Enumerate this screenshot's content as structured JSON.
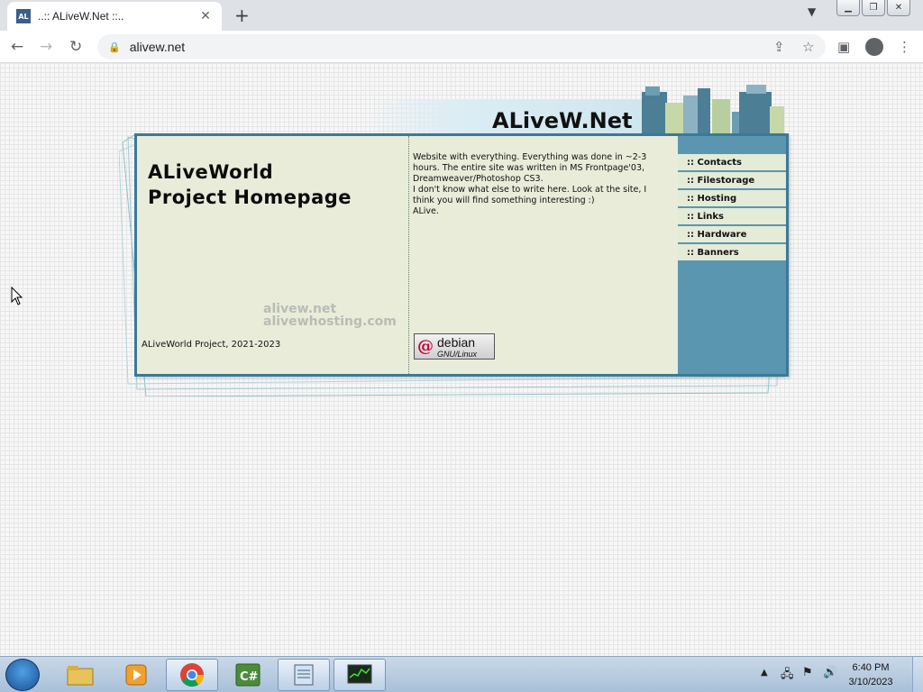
{
  "browser": {
    "tab_title": "..:: ALiveW.Net ::..",
    "favicon_text": "AL",
    "new_tab": "+",
    "close": "✕",
    "url": "alivew.net"
  },
  "site": {
    "title": "ALiveW.Net",
    "heading_line1": "ALiveWorld",
    "heading_line2": "Project Homepage",
    "watermark_line1": "alivew.net",
    "watermark_line2": "alivewhosting.com",
    "copyright": "ALiveWorld Project, 2021-2023",
    "description": [
      "Website with everything. Everything was done in ~2-3",
      "hours. The entire site was written in MS Frontpage'03,",
      "Dreamweaver/Photoshop CS3.",
      "I don't know what else to write here. Look at the site, I",
      "think you will find something interesting :)",
      "ALive."
    ],
    "debian_line1": "debian",
    "debian_line2": "GNU/Linux",
    "menu": [
      ":: Contacts",
      ":: Filestorage",
      ":: Hosting",
      ":: Links",
      ":: Hardware",
      ":: Banners"
    ]
  },
  "taskbar": {
    "time": "6:40 PM",
    "date": "3/10/2023"
  },
  "colors": {
    "accent": "#3a7a98",
    "panel": "#e8ecd9",
    "sidebar": "#5a96b0"
  }
}
